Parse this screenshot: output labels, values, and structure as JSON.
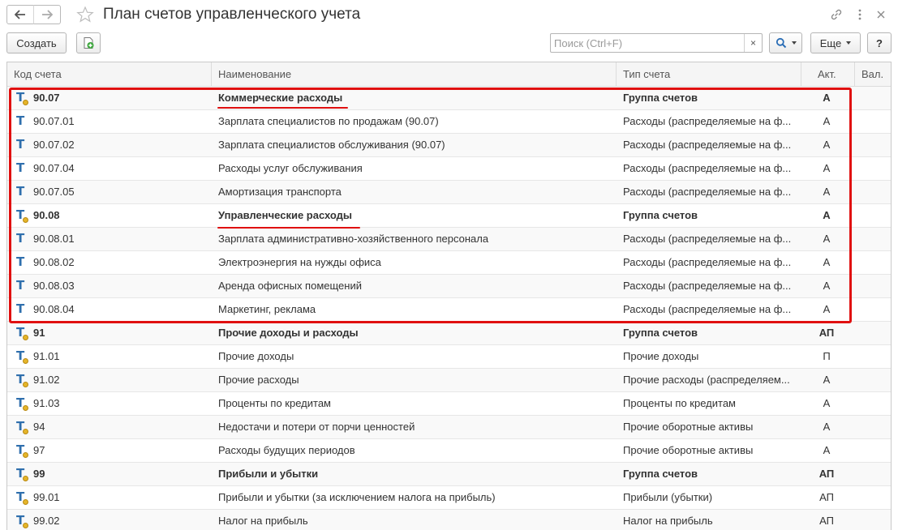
{
  "window": {
    "title": "План счетов управленческого учета"
  },
  "toolbar": {
    "create_label": "Создать",
    "search_placeholder": "Поиск (Ctrl+F)",
    "search_clear": "×",
    "more_label": "Еще",
    "help_label": "?"
  },
  "table": {
    "headers": {
      "code": "Код счета",
      "name": "Наименование",
      "type": "Тип счета",
      "akt": "Акт.",
      "val": "Вал."
    },
    "rows": [
      {
        "code": "90.07",
        "name": "Коммерческие расходы",
        "type": "Группа счетов",
        "akt": "А",
        "group": true
      },
      {
        "code": "90.07.01",
        "name": "Зарплата специалистов по продажам (90.07)",
        "type": "Расходы (распределяемые на ф...",
        "akt": "А",
        "group": false
      },
      {
        "code": "90.07.02",
        "name": "Зарплата специалистов обслуживания (90.07)",
        "type": "Расходы (распределяемые на ф...",
        "akt": "А",
        "group": false
      },
      {
        "code": "90.07.04",
        "name": "Расходы услуг обслуживания",
        "type": "Расходы (распределяемые на ф...",
        "akt": "А",
        "group": false
      },
      {
        "code": "90.07.05",
        "name": "Амортизация транспорта",
        "type": "Расходы (распределяемые на ф...",
        "akt": "А",
        "group": false
      },
      {
        "code": "90.08",
        "name": "Управленческие расходы",
        "type": "Группа счетов",
        "akt": "А",
        "group": true
      },
      {
        "code": "90.08.01",
        "name": "Зарплата административно-хозяйственного персонала",
        "type": "Расходы (распределяемые на ф...",
        "akt": "А",
        "group": false
      },
      {
        "code": "90.08.02",
        "name": "Электроэнергия на нужды офиса",
        "type": "Расходы (распределяемые на ф...",
        "akt": "А",
        "group": false
      },
      {
        "code": "90.08.03",
        "name": "Аренда офисных помещений",
        "type": "Расходы (распределяемые на ф...",
        "akt": "А",
        "group": false
      },
      {
        "code": "90.08.04",
        "name": "Маркетинг, реклама",
        "type": "Расходы (распределяемые на ф...",
        "akt": "А",
        "group": false
      },
      {
        "code": "91",
        "name": "Прочие доходы и расходы",
        "type": "Группа счетов",
        "akt": "АП",
        "group": true
      },
      {
        "code": "91.01",
        "name": "Прочие доходы",
        "type": "Прочие доходы",
        "akt": "П",
        "group": false
      },
      {
        "code": "91.02",
        "name": "Прочие расходы",
        "type": "Прочие расходы (распределяем...",
        "akt": "А",
        "group": false
      },
      {
        "code": "91.03",
        "name": "Проценты по кредитам",
        "type": "Проценты по кредитам",
        "akt": "А",
        "group": false
      },
      {
        "code": "94",
        "name": "Недостачи и потери от порчи ценностей",
        "type": "Прочие оборотные активы",
        "akt": "А",
        "group": false
      },
      {
        "code": "97",
        "name": "Расходы будущих периодов",
        "type": "Прочие оборотные активы",
        "akt": "А",
        "group": false
      },
      {
        "code": "99",
        "name": "Прибыли и убытки",
        "type": "Группа счетов",
        "akt": "АП",
        "group": true
      },
      {
        "code": "99.01",
        "name": "Прибыли и убытки (за исключением налога на прибыль)",
        "type": "Прибыли (убытки)",
        "akt": "АП",
        "group": false
      },
      {
        "code": "99.02",
        "name": "Налог на прибыль",
        "type": "Налог на прибыль",
        "akt": "АП",
        "group": false
      }
    ]
  },
  "colors": {
    "annotation": "#e01010",
    "icon_blue": "#2f6fad",
    "icon_yellow": "#e5b52a"
  },
  "icons": {
    "back": "arrow-left-icon",
    "forward": "arrow-right-icon",
    "favorite": "star-icon",
    "link": "link-icon",
    "menu": "more-vertical-icon",
    "close": "close-icon",
    "add": "add-document-icon",
    "search": "search-icon",
    "account": "account-t-icon"
  }
}
